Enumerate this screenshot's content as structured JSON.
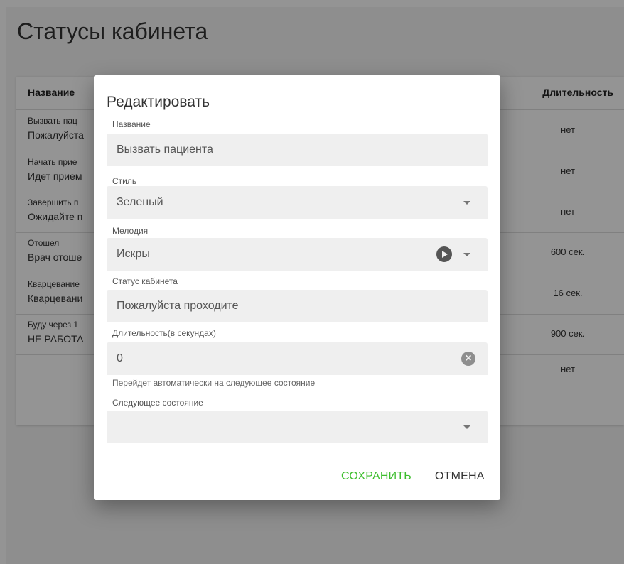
{
  "page": {
    "title": "Статусы кабинета"
  },
  "table": {
    "headers": {
      "name": "Название",
      "duration": "Длительность"
    },
    "rows": [
      {
        "title": "Вызвать пац",
        "status": "Пожалуйста",
        "duration": "нет"
      },
      {
        "title": "Начать прие",
        "status": "Идет прием",
        "duration": "нет"
      },
      {
        "title": "Завершить п",
        "status": "Ожидайте п",
        "duration": "нет"
      },
      {
        "title": "Отошел",
        "status": "Врач отоше",
        "duration": "600 сек."
      },
      {
        "title": "Кварцевание",
        "status": "Кварцевани",
        "duration": "16 сек."
      },
      {
        "title": "Буду через 1",
        "status": "НЕ РАБОТА",
        "duration": "900 сек."
      },
      {
        "title": "",
        "status": "",
        "duration": "нет"
      }
    ]
  },
  "dialog": {
    "title": "Редактировать",
    "name": {
      "label": "Название",
      "value": "Вызвать пациента"
    },
    "style": {
      "label": "Стиль",
      "value": "Зеленый"
    },
    "melody": {
      "label": "Мелодия",
      "value": "Искры"
    },
    "cabinet_status": {
      "label": "Статус кабинета",
      "value": "Пожалуйста проходите"
    },
    "duration": {
      "label": "Длительность(в секундах)",
      "value": "0",
      "hint": "Перейдет автоматически на следующее состояние"
    },
    "next_state": {
      "label": "Следующее состояние",
      "value": ""
    },
    "save_label": "СОХРАНИТЬ",
    "cancel_label": "ОТМЕНА"
  },
  "colors": {
    "accent": "#3dbd2d",
    "overlay": "rgba(0,0,0,0.42)"
  }
}
